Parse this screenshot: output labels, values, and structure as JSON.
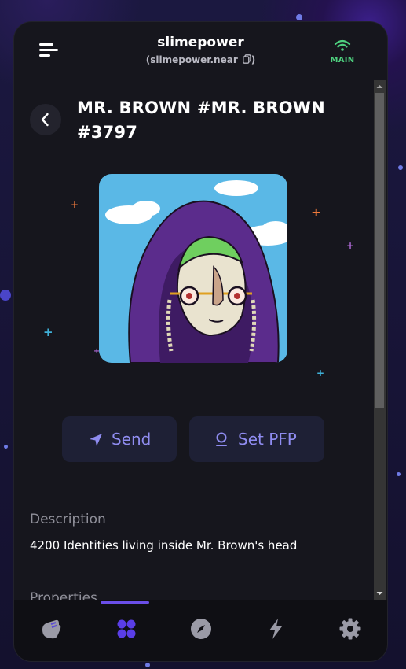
{
  "header": {
    "account_name": "slimepower",
    "account_id": "(slimepower.near",
    "account_id_close": ")",
    "network_label": "MAIN",
    "network_color": "#4ed07f"
  },
  "nft": {
    "title": "MR. BROWN #MR. BROWN #3797",
    "image_icon": "nft-artwork-hooded-character"
  },
  "actions": {
    "send_label": "Send",
    "set_pfp_label": "Set PFP",
    "accent_color": "#8f8cf0"
  },
  "details": {
    "description_label": "Description",
    "description_text": "4200 Identities living inside Mr. Brown's head",
    "properties_label": "Properties"
  },
  "bottom_nav": {
    "items": [
      {
        "icon": "wallet-icon"
      },
      {
        "icon": "collectibles-icon",
        "active": true
      },
      {
        "icon": "explore-compass-icon"
      },
      {
        "icon": "activity-bolt-icon"
      },
      {
        "icon": "settings-gear-icon"
      }
    ]
  }
}
